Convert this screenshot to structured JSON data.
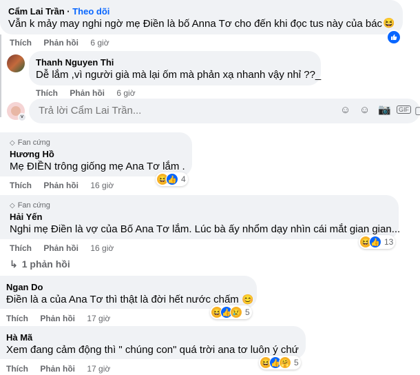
{
  "c1": {
    "name": "Cẩm Lai Trần",
    "follow": "Theo dõi",
    "text": "Vẫn k mảy may nghi ngờ mẹ Điền là bố Anna Tơ cho đến khi đọc tus này của bác",
    "like": "Thích",
    "reply": "Phản hồi",
    "time": "6 giờ"
  },
  "c2": {
    "name": "Thanh Nguyen Thi",
    "text": "Dễ lắm ,vì người già mà lại ốm mà phản xạ nhanh vậy nhỉ ??_",
    "like": "Thích",
    "reply": "Phản hồi",
    "time": "6 giờ"
  },
  "replyInput": {
    "placeholder": "Trả lời Cẩm Lai Trần..."
  },
  "c3": {
    "badge": "Fan cứng",
    "name": "Hương Hồ",
    "text": "Mẹ ĐIỀN trông giống mẹ Ana Tơ lắm .",
    "like": "Thích",
    "reply": "Phản hồi",
    "time": "16 giờ",
    "reactCount": "4"
  },
  "c4": {
    "badge": "Fan cứng",
    "name": "Hải Yến",
    "text": "Nghi mẹ Điền là vợ của Bố Ana Tơ lắm. Lúc bà ấy nhổm dạy nhìn cái mắt gian gian...",
    "like": "Thích",
    "reply": "Phản hồi",
    "time": "16 giờ",
    "reactCount": "13",
    "repliesLink": "1 phản hồi"
  },
  "c5": {
    "name": "Ngan Do",
    "text": "Điền là a của Ana Tơ thì thật là đời hết nước chấm",
    "like": "Thích",
    "reply": "Phản hồi",
    "time": "17 giờ",
    "reactCount": "5"
  },
  "c6": {
    "name": "Hà Mã",
    "text": "Xem đang cảm động thì \" chúng con\" quá trời ana tơ luôn ý chứ",
    "like": "Thích",
    "reply": "Phản hồi",
    "time": "17 giờ",
    "reactCount": "5"
  },
  "icons": {
    "haha": "haha-emoji",
    "like": "like-thumb",
    "sad": "sad-emoji",
    "care": "care-emoji"
  }
}
